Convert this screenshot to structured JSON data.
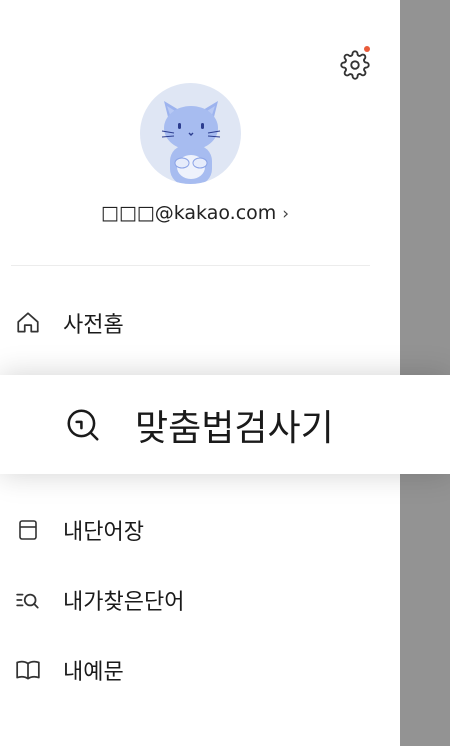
{
  "drawer": {
    "account": {
      "email": "□□□@kakao.com",
      "chevron": "›"
    },
    "settings": {
      "icon": "gear-icon",
      "has_notification": true,
      "notification_color": "#e95b3a"
    },
    "avatar": {
      "icon": "cat-avatar-icon",
      "bg_color": "#dfe6f4"
    }
  },
  "menu": [
    {
      "id": "home",
      "label": "사전홈",
      "icon": "home-icon"
    },
    {
      "id": "custom-grammar",
      "label": "맞춤법검사기",
      "icon": "search-check-icon",
      "highlighted": true
    },
    {
      "id": "wordbook",
      "label": "내단어장",
      "icon": "notebook-icon"
    },
    {
      "id": "search-history",
      "label": "내가찾은단어",
      "icon": "list-search-icon"
    },
    {
      "id": "examples",
      "label": "내예문",
      "icon": "open-book-icon"
    }
  ],
  "colors": {
    "scrim": "#939393",
    "text": "#1a1a1a"
  }
}
